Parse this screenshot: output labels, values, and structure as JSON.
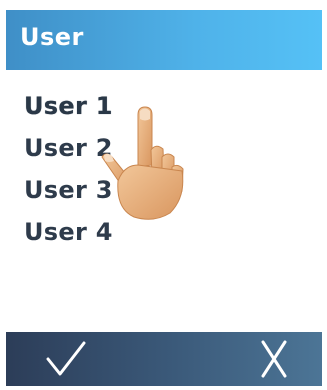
{
  "header": {
    "title": "User"
  },
  "users": [
    {
      "label": "User 1",
      "selected": true
    },
    {
      "label": "User 2",
      "selected": false
    },
    {
      "label": "User 3",
      "selected": false
    },
    {
      "label": "User 4",
      "selected": false
    }
  ],
  "footer": {
    "confirm_icon": "checkmark-icon",
    "cancel_icon": "x-icon"
  },
  "colors": {
    "header_start": "#3f8fc7",
    "header_end": "#55c1f6",
    "footer_start": "#2c3d58",
    "footer_end": "#4c7596",
    "text": "#2e3b4b"
  },
  "overlay": {
    "icon": "pointing-hand-icon"
  }
}
